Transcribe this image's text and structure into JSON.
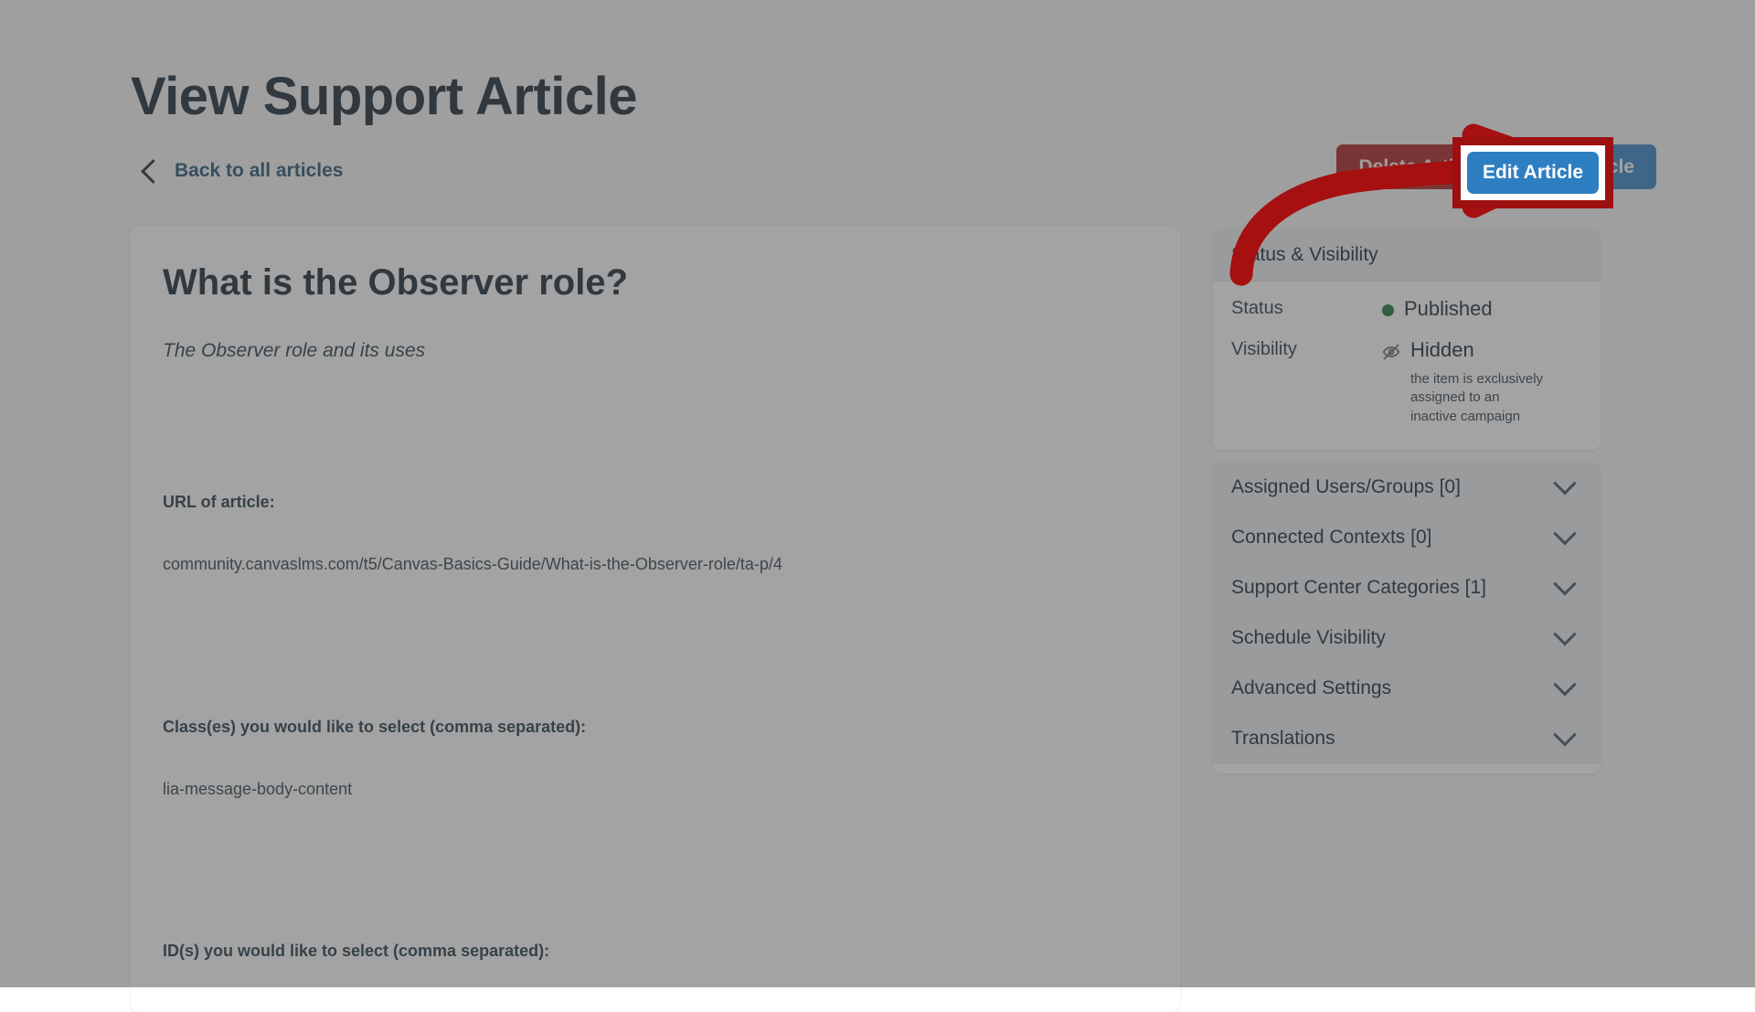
{
  "page": {
    "title": "View Support Article",
    "back_link": "Back to all articles",
    "back_icon": "chevron-left-icon"
  },
  "actions": {
    "delete_label": "Delete Article",
    "edit_label": "Edit Article",
    "delete_color": "#a71d1d",
    "edit_color": "#2e7fc2"
  },
  "article": {
    "heading": "What is the Observer role?",
    "subtitle": "The Observer role and its uses",
    "fields": [
      {
        "label": "URL of article:",
        "value": "community.canvaslms.com/t5/Canvas-Basics-Guide/What-is-the-Observer-role/ta-p/4"
      },
      {
        "label": "Class(es) you would like to select (comma separated):",
        "value": "lia-message-body-content"
      },
      {
        "label": "ID(s) you would like to select (comma separated):",
        "value": ""
      }
    ]
  },
  "sidebar": {
    "status_panel": {
      "header": "Status & Visibility",
      "rows": [
        {
          "key": "Status",
          "value": "Published",
          "icon": "green-dot-icon",
          "icon_color": "#186b35",
          "note": ""
        },
        {
          "key": "Visibility",
          "value": "Hidden",
          "icon": "eye-off-icon",
          "icon_color": "#55636d",
          "note": "the item is exclusively assigned to an inactive campaign"
        }
      ]
    },
    "accordion": [
      {
        "label": "Assigned Users/Groups [0]",
        "icon": "chevron-down-icon"
      },
      {
        "label": "Connected Contexts [0]",
        "icon": "chevron-down-icon"
      },
      {
        "label": "Support Center Categories [1]",
        "icon": "chevron-down-icon"
      },
      {
        "label": "Schedule Visibility",
        "icon": "chevron-down-icon"
      },
      {
        "label": "Advanced Settings",
        "icon": "chevron-down-icon"
      },
      {
        "label": "Translations",
        "icon": "chevron-down-icon"
      }
    ]
  },
  "annotation": {
    "highlight_color": "#9d1010",
    "arrow_color": "#a71010",
    "highlight_target": "Edit Article",
    "edit_label": "Edit Article"
  }
}
